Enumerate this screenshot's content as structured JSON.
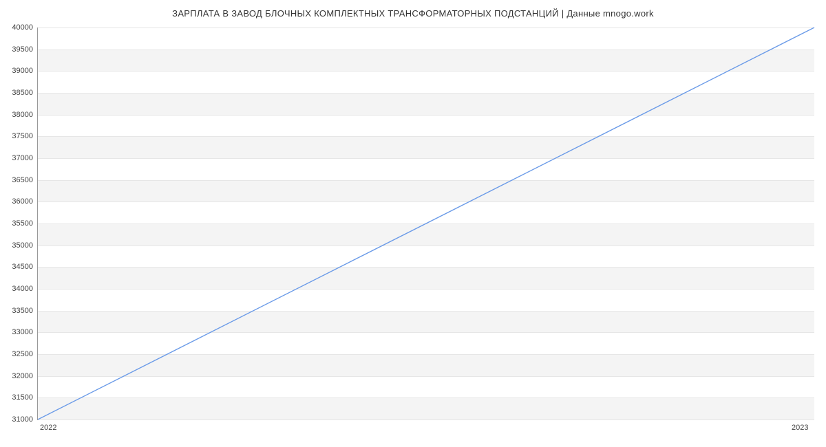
{
  "chart_data": {
    "type": "line",
    "title": "ЗАРПЛАТА В  ЗАВОД БЛОЧНЫХ КОМПЛЕКТНЫХ ТРАНСФОРМАТОРНЫХ ПОДСТАНЦИЙ | Данные mnogo.work",
    "x": [
      "2022",
      "2023"
    ],
    "values": [
      31000,
      40000
    ],
    "xlabel": "",
    "ylabel": "",
    "ylim": [
      31000,
      40000
    ],
    "yticks": [
      31000,
      31500,
      32000,
      32500,
      33000,
      33500,
      34000,
      34500,
      35000,
      35500,
      36000,
      36500,
      37000,
      37500,
      38000,
      38500,
      39000,
      39500,
      40000
    ],
    "line_color": "#6b9be8"
  }
}
